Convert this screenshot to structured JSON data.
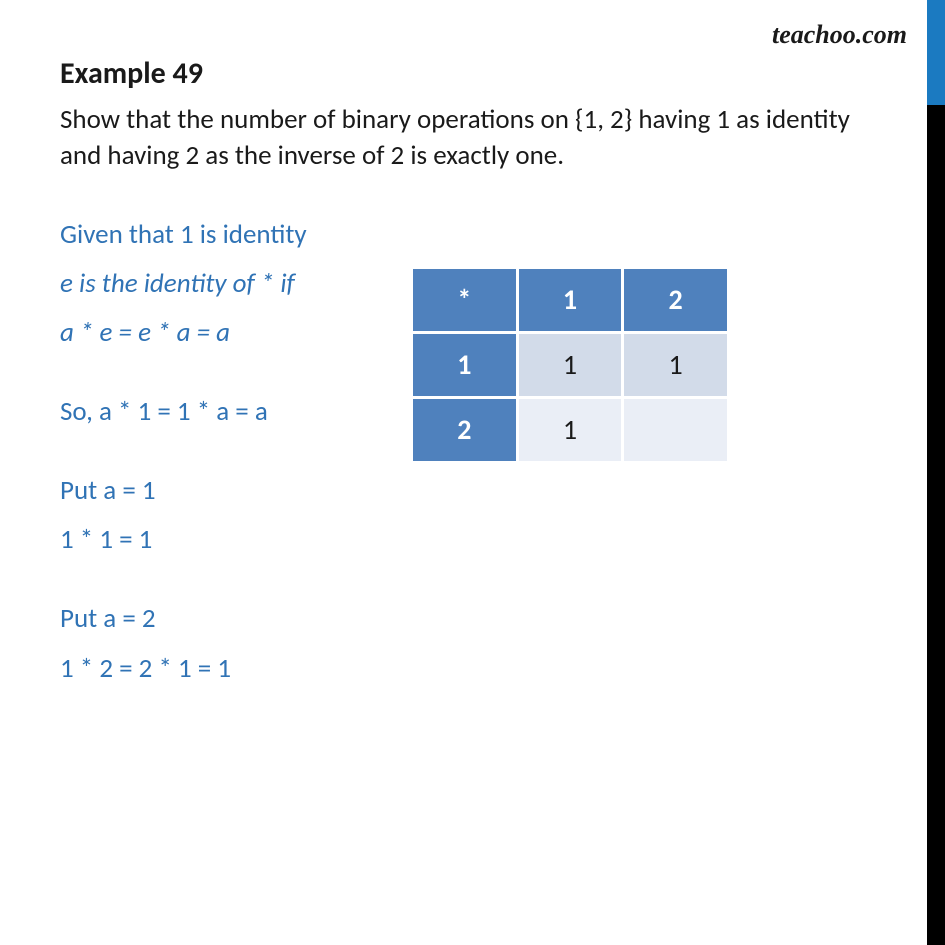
{
  "watermark": "teachoo.com",
  "title": "Example 49",
  "problem": "Show that the number of binary operations on {1, 2} having 1 as identity and having 2 as the inverse of 2 is exactly one.",
  "steps": {
    "given": "Given that 1 is identity",
    "def": "e is the identity of * if",
    "eq1": "a * e  = e * a = a",
    "so": "So, a * 1 = 1 * a = a",
    "put1": "Put a = 1",
    "res1": "1 * 1 = 1",
    "put2": "Put a = 2",
    "res2": "1 * 2 = 2 * 1 = 1"
  },
  "table": {
    "head": [
      "*",
      "1",
      "2"
    ],
    "rows": [
      [
        "1",
        "1",
        "1"
      ],
      [
        "2",
        "1",
        ""
      ]
    ]
  }
}
